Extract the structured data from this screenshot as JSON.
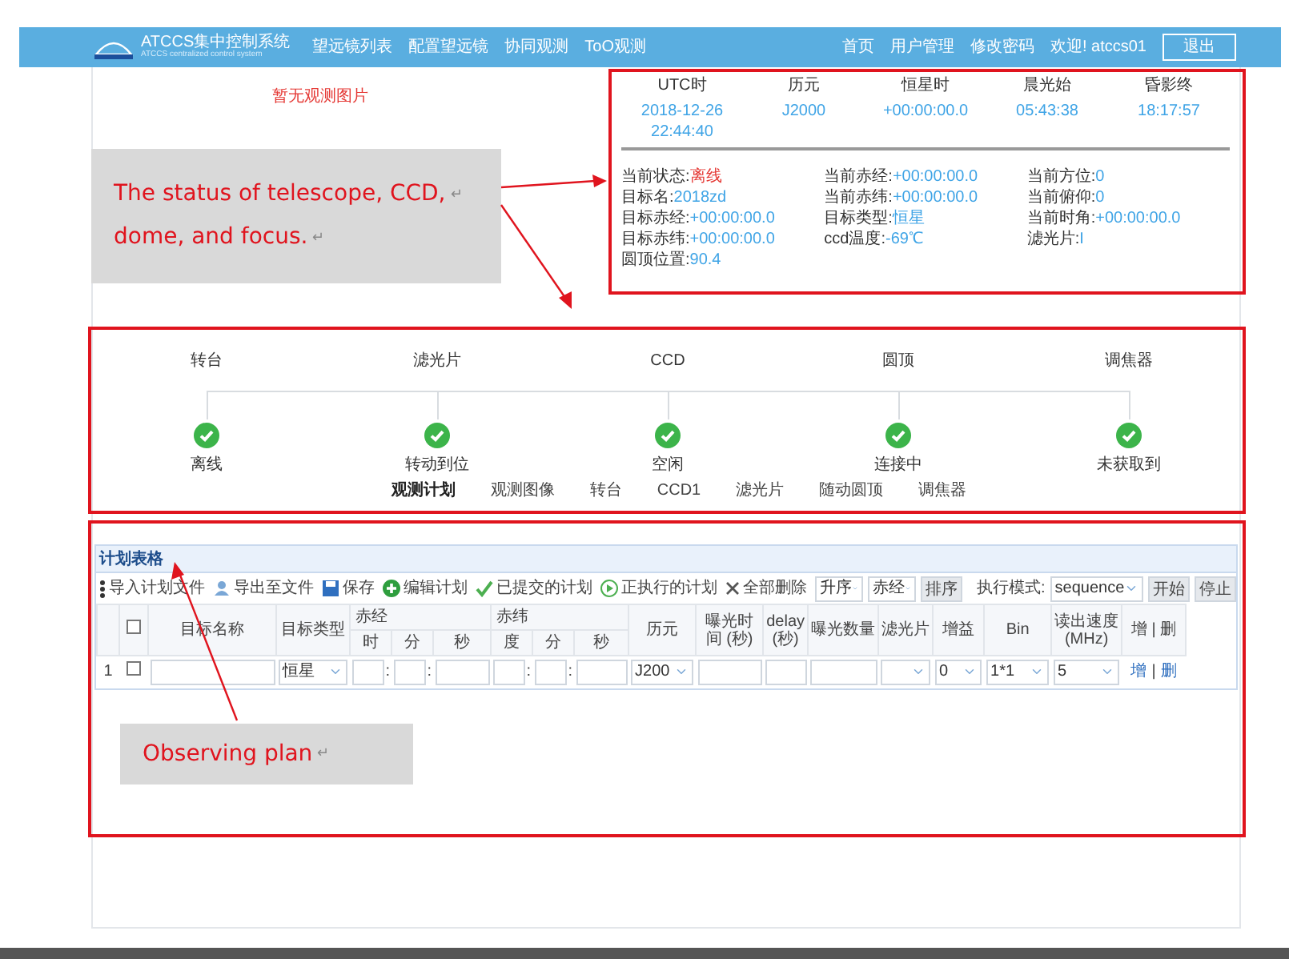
{
  "nav": {
    "brand": "ATCCS集中控制系统",
    "brand_subtitle": "ATCCS centralized control system",
    "links": [
      "望远镜列表",
      "配置望远镜",
      "协同观测",
      "ToO观测"
    ],
    "right_links": [
      "首页",
      "用户管理",
      "修改密码"
    ],
    "welcome": "欢迎! atccs01",
    "logout": "退出"
  },
  "image_placeholder": "暂无观测图片",
  "time_table": [
    {
      "label": "UTC时",
      "value": "2018-12-26 22:44:40"
    },
    {
      "label": "历元",
      "value": "J2000"
    },
    {
      "label": "恒星时",
      "value": "+00:00:00.0"
    },
    {
      "label": "晨光始",
      "value": "05:43:38"
    },
    {
      "label": "昏影终",
      "value": "18:17:57"
    }
  ],
  "status": [
    {
      "label": "当前状态:",
      "value": "离线",
      "color": "#e53935"
    },
    {
      "label": "当前赤经:",
      "value": "+00:00:00.0",
      "color": "#3fa4e6"
    },
    {
      "label": "当前方位:",
      "value": "0",
      "color": "#3fa4e6"
    },
    {
      "label": "目标名:",
      "value": "2018zd",
      "color": "#3fa4e6"
    },
    {
      "label": "当前赤纬:",
      "value": "+00:00:00.0",
      "color": "#3fa4e6"
    },
    {
      "label": "当前俯仰:",
      "value": "0",
      "color": "#3fa4e6"
    },
    {
      "label": "目标赤经:",
      "value": "+00:00:00.0",
      "color": "#3fa4e6"
    },
    {
      "label": "目标类型:",
      "value": "恒星",
      "color": "#3fa4e6"
    },
    {
      "label": "当前时角:",
      "value": "+00:00:00.0",
      "color": "#3fa4e6"
    },
    {
      "label": "目标赤纬:",
      "value": "+00:00:00.0",
      "color": "#3fa4e6"
    },
    {
      "label": "ccd温度:",
      "value": "-69℃",
      "color": "#3fa4e6"
    },
    {
      "label": "滤光片:",
      "value": "I",
      "color": "#3fa4e6"
    },
    {
      "label": "圆顶位置:",
      "value": "90.4",
      "color": "#3fa4e6"
    }
  ],
  "devices": [
    {
      "name": "转台",
      "status": "离线",
      "done": true
    },
    {
      "name": "滤光片",
      "status": "转动到位",
      "done": true
    },
    {
      "name": "CCD",
      "status": "空闲",
      "done": true
    },
    {
      "name": "圆顶",
      "status": "连接中",
      "done": true
    },
    {
      "name": "调焦器",
      "status": "未获取到",
      "done": true
    }
  ],
  "tabs": [
    {
      "label": "观测计划",
      "selected": true
    },
    {
      "label": "观测图像",
      "selected": false
    },
    {
      "label": "转台",
      "selected": false
    },
    {
      "label": "CCD1",
      "selected": false
    },
    {
      "label": "滤光片",
      "selected": false
    },
    {
      "label": "随动圆顶",
      "selected": false
    },
    {
      "label": "调焦器",
      "selected": false
    }
  ],
  "plan": {
    "title": "计划表格",
    "toolbar": [
      "导入计划文件",
      "导出至文件",
      "保存",
      "编辑计划",
      "已提交的计划",
      "正执行的计划",
      "全部删除"
    ],
    "sort_order": "升序",
    "sort_field": "赤经",
    "sort_button": "排序",
    "mode_label": "执行模式:",
    "mode": "sequence",
    "start": "开始",
    "stop": "停止",
    "header_checked": false,
    "columns": [
      {
        "label": "目标名称"
      },
      {
        "label": "目标类型"
      },
      {
        "label": "赤经",
        "colspan": 3,
        "children": [
          "时",
          "分",
          "秒"
        ]
      },
      {
        "label": "赤纬",
        "colspan": 3,
        "children": [
          "度",
          "分",
          "秒"
        ]
      },
      {
        "label": "历元"
      },
      {
        "label": "曝光时间 (秒)"
      },
      {
        "label": "delay (秒)"
      },
      {
        "label": "曝光数量"
      },
      {
        "label": "滤光片"
      },
      {
        "label": "增益"
      },
      {
        "label": "Bin"
      },
      {
        "label": "读出速度 (MHz)"
      },
      {
        "label": "增 | 删"
      }
    ],
    "rows": [
      {
        "index": "1",
        "checked": false,
        "add": "增",
        "separator": "|",
        "delete": "删",
        "cells": [
          {
            "kind": "input"
          },
          {
            "kind": "select",
            "value": "恒星"
          },
          {
            "kind": "input",
            "suffix": ":"
          },
          {
            "kind": "input",
            "suffix": ":"
          },
          {
            "kind": "input"
          },
          {
            "kind": "input",
            "suffix": ":"
          },
          {
            "kind": "input",
            "suffix": ":"
          },
          {
            "kind": "input"
          },
          {
            "kind": "select",
            "value": "J200"
          },
          {
            "kind": "input"
          },
          {
            "kind": "input"
          },
          {
            "kind": "input"
          },
          {
            "kind": "select"
          },
          {
            "kind": "select",
            "value": "0"
          },
          {
            "kind": "select",
            "value": "1*1"
          },
          {
            "kind": "select",
            "value": "5"
          }
        ]
      }
    ]
  },
  "annotations": [
    {
      "lines": [
        {
          "text": "The status of telescope, CCD,",
          "mark": "↵"
        },
        {
          "text": "dome, and focus.",
          "mark": "↵"
        }
      ]
    },
    {
      "lines": [
        {
          "text": "Observing plan",
          "mark": "↵"
        }
      ]
    }
  ]
}
